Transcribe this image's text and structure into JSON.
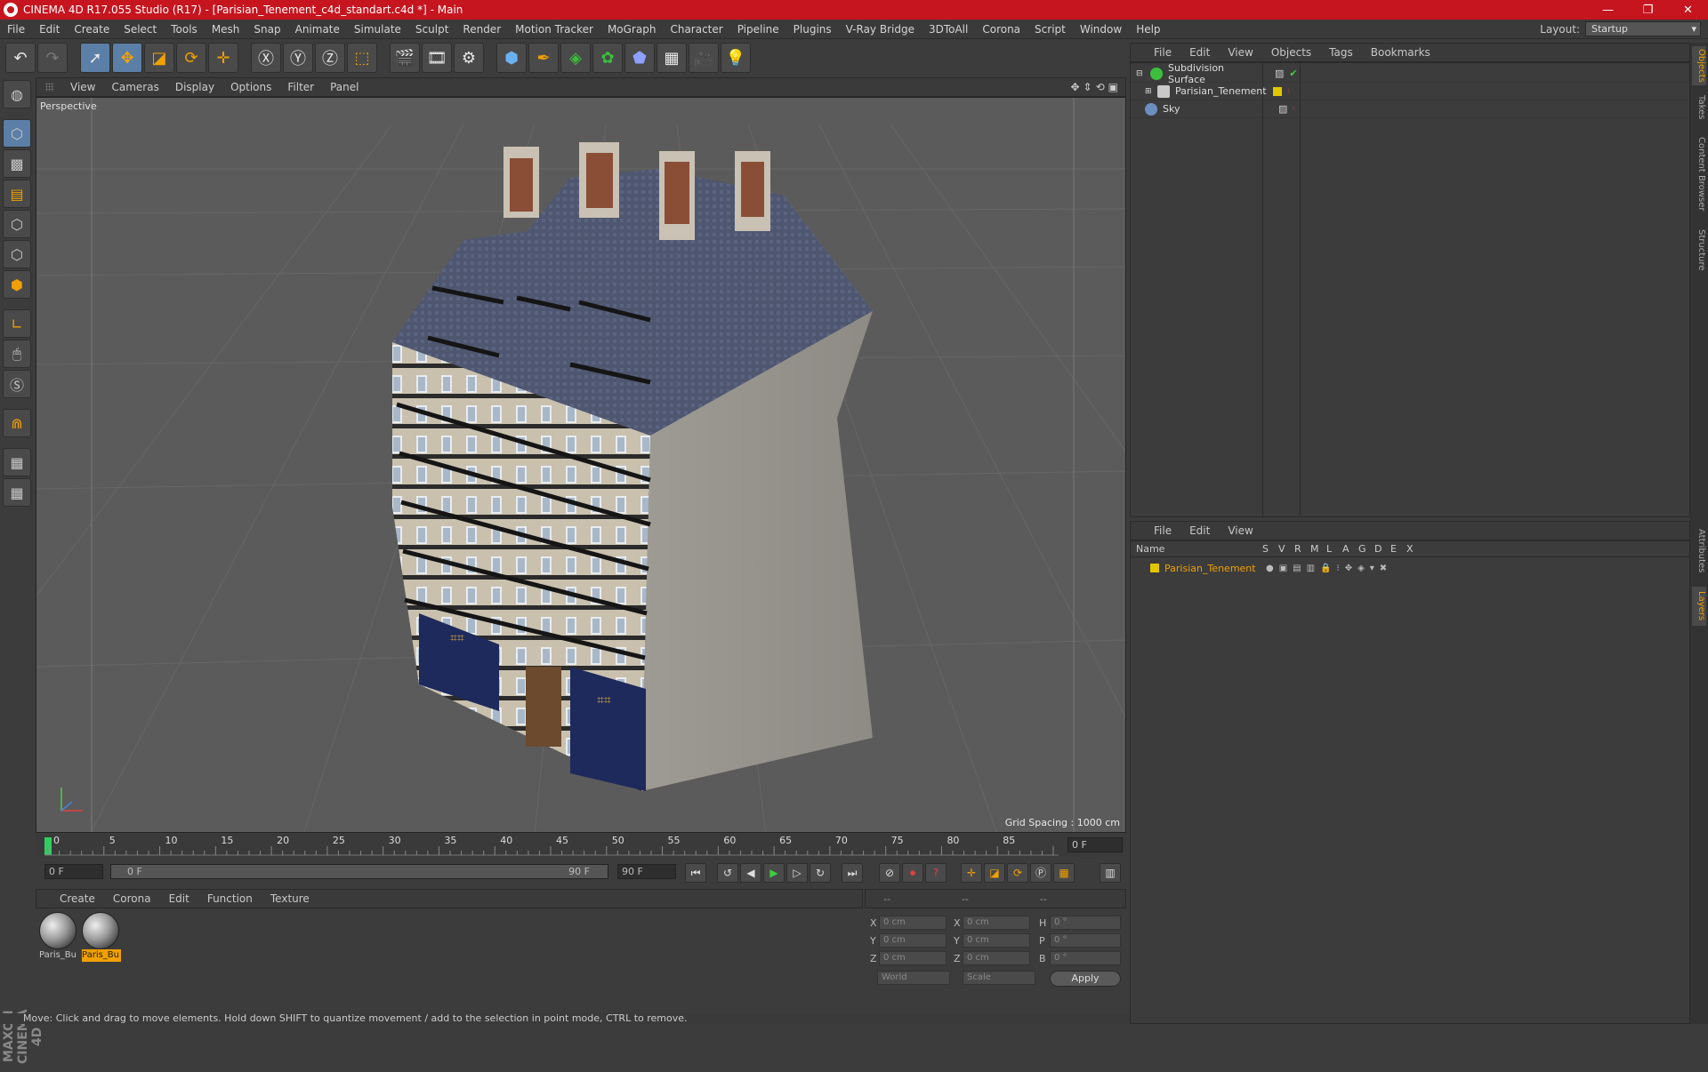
{
  "window": {
    "title": "CINEMA 4D R17.055 Studio (R17) - [Parisian_Tenement_c4d_standart.c4d *] - Main",
    "minimize": "—",
    "maximize": "❐",
    "close": "✕"
  },
  "menu": [
    "File",
    "Edit",
    "Create",
    "Select",
    "Tools",
    "Mesh",
    "Snap",
    "Animate",
    "Simulate",
    "Sculpt",
    "Render",
    "Motion Tracker",
    "MoGraph",
    "Character",
    "Pipeline",
    "Plugins",
    "V-Ray Bridge",
    "3DToAll",
    "Corona",
    "Script",
    "Window",
    "Help"
  ],
  "layout": {
    "label": "Layout:",
    "value": "Startup"
  },
  "viewport": {
    "menu": [
      "View",
      "Cameras",
      "Display",
      "Options",
      "Filter",
      "Panel"
    ],
    "label": "Perspective",
    "grid_spacing": "Grid Spacing : 1000 cm"
  },
  "timeline": {
    "ticks": [
      "0",
      "5",
      "10",
      "15",
      "20",
      "25",
      "30",
      "35",
      "40",
      "45",
      "50",
      "55",
      "60",
      "65",
      "70",
      "75",
      "80",
      "85",
      "90"
    ],
    "current_frame": "0 F",
    "start_field": "0 F",
    "range_start": "0 F",
    "range_end": "90 F",
    "end_field": "90 F"
  },
  "materials": {
    "menu": [
      "Create",
      "Corona",
      "Edit",
      "Function",
      "Texture"
    ],
    "items": [
      {
        "label": "Paris_Bu",
        "selected": false
      },
      {
        "label": "Paris_Bu",
        "selected": true
      }
    ]
  },
  "coordinates": {
    "head": [
      "--",
      "--",
      "--"
    ],
    "rows": [
      {
        "a": "X",
        "av": "0 cm",
        "b": "X",
        "bv": "0 cm",
        "c": "H",
        "cv": "0 °"
      },
      {
        "a": "Y",
        "av": "0 cm",
        "b": "Y",
        "bv": "0 cm",
        "c": "P",
        "cv": "0 °"
      },
      {
        "a": "Z",
        "av": "0 cm",
        "b": "Z",
        "bv": "0 cm",
        "c": "B",
        "cv": "0 °"
      }
    ],
    "world": "World",
    "scale": "Scale",
    "apply": "Apply"
  },
  "status": "Move: Click and drag to move elements. Hold down SHIFT to quantize movement / add to the selection in point mode, CTRL to remove.",
  "object_manager": {
    "menu": [
      "File",
      "Edit",
      "View",
      "Objects",
      "Tags",
      "Bookmarks"
    ],
    "objects": [
      {
        "name": "Subdivision Surface",
        "color": "#3cbf3c"
      },
      {
        "name": "Parisian_Tenement",
        "color": "#cccccc"
      },
      {
        "name": "Sky",
        "color": "#6c8fc0"
      }
    ]
  },
  "layer_manager": {
    "menu": [
      "File",
      "Edit",
      "View"
    ],
    "columns": [
      "Name",
      "S",
      "V",
      "R",
      "M",
      "L",
      "A",
      "G",
      "D",
      "E",
      "X"
    ],
    "layers": [
      {
        "name": "Parisian_Tenement",
        "color": "#e0c800"
      }
    ]
  },
  "side_tabs": [
    "Objects",
    "Takes",
    "Content Browser",
    "Structure",
    "Attributes",
    "Layers"
  ],
  "maxon_brand": "MAXON CINEMA 4D",
  "colors": {
    "accent": "#f0a000",
    "title_bar": "#c6151f",
    "active_tool": "#5b7fa6"
  }
}
